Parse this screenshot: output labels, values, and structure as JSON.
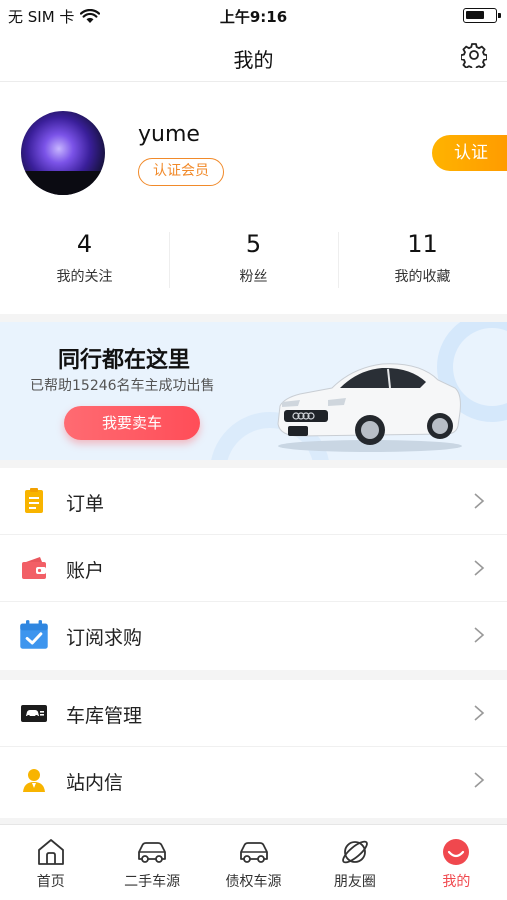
{
  "status_bar": {
    "carrier": "无 SIM 卡",
    "time": "上午9:16"
  },
  "nav": {
    "title": "我的"
  },
  "profile": {
    "username": "yume",
    "member_badge": "认证会员",
    "verify_button": "认证",
    "stats": [
      {
        "value": "4",
        "label": "我的关注"
      },
      {
        "value": "5",
        "label": "粉丝"
      },
      {
        "value": "11",
        "label": "我的收藏"
      }
    ]
  },
  "banner": {
    "headline": "同行都在这里",
    "subtitle": "已帮助15246名车主成功出售",
    "button": "我要卖车"
  },
  "menu": {
    "group1": [
      {
        "label": "订单",
        "icon": "clipboard-icon"
      },
      {
        "label": "账户",
        "icon": "wallet-icon"
      },
      {
        "label": "订阅求购",
        "icon": "calendar-check-icon"
      }
    ],
    "group2": [
      {
        "label": "车库管理",
        "icon": "garage-card-icon"
      },
      {
        "label": "站内信",
        "icon": "person-message-icon"
      }
    ]
  },
  "tabbar": {
    "tabs": [
      {
        "label": "首页",
        "icon": "home-icon"
      },
      {
        "label": "二手车源",
        "icon": "car-icon"
      },
      {
        "label": "债权车源",
        "icon": "car-icon"
      },
      {
        "label": "朋友圈",
        "icon": "planet-icon"
      },
      {
        "label": "我的",
        "icon": "smile-icon",
        "active": true
      }
    ]
  },
  "colors": {
    "accent_orange": "#f18a2a",
    "verify_orange": "#ffa600",
    "sell_red": "#ff5560",
    "active_tab": "#f0484e",
    "banner_bg": "#e9f3fd"
  }
}
